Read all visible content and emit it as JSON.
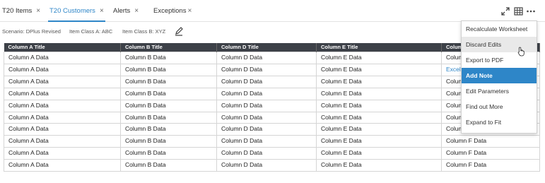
{
  "tabs": [
    {
      "label": "T20 Items",
      "active": false
    },
    {
      "label": "T20 Customers",
      "active": true
    },
    {
      "label": "Alerts",
      "active": false
    },
    {
      "label": "Exceptions",
      "active": false
    }
  ],
  "tab_close_glyph": "×",
  "toolbar": {
    "icons": [
      "expand-icon",
      "grid-icon",
      "more-icon"
    ]
  },
  "scenario_bar": {
    "scenario": "Scenario: DPlus Revised",
    "item_class_a": "Item Class A: ABC",
    "item_class_b": "Item Class B: XYZ"
  },
  "table": {
    "columns": [
      "Column A Title",
      "Column B Title",
      "Column D Title",
      "Column E Title",
      "Column F Title"
    ],
    "rows": [
      [
        "Column A Data",
        "Column B Data",
        "Column D Data",
        "Column E Data",
        "Column F Data"
      ],
      [
        "Column A Data",
        "Column B Data",
        "Column D Data",
        "Column E Data",
        "Excel"
      ],
      [
        "Column A Data",
        "Column B Data",
        "Column D Data",
        "Column E Data",
        "Column F Data"
      ],
      [
        "Column A Data",
        "Column B Data",
        "Column D Data",
        "Column E Data",
        "Column F Data"
      ],
      [
        "Column A Data",
        "Column B Data",
        "Column D Data",
        "Column E Data",
        "Column F Data"
      ],
      [
        "Column A Data",
        "Column B Data",
        "Column D Data",
        "Column E Data",
        "Column F Data"
      ],
      [
        "Column A Data",
        "Column B Data",
        "Column D Data",
        "Column E Data",
        "Column F Data"
      ],
      [
        "Column A Data",
        "Column B Data",
        "Column D Data",
        "Column E Data",
        "Column F Data"
      ],
      [
        "Column A Data",
        "Column B Data",
        "Column D Data",
        "Column E Data",
        "Column F Data"
      ],
      [
        "Column A Data",
        "Column B Data",
        "Column D Data",
        "Column E Data",
        "Column F Data"
      ]
    ],
    "link_cell": {
      "row": 1,
      "col": 4
    }
  },
  "menu": {
    "items": [
      {
        "label": "Recalculate Worksheet",
        "state": "normal"
      },
      {
        "label": "Discard Edits",
        "state": "hover"
      },
      {
        "label": "Export to PDF",
        "state": "normal"
      },
      {
        "label": "Add Note",
        "state": "selected"
      },
      {
        "label": "Edit Parameters",
        "state": "normal"
      },
      {
        "label": "Find out More",
        "state": "normal"
      },
      {
        "label": "Expand to Fit",
        "state": "normal"
      }
    ]
  },
  "colors": {
    "accent": "#2e86c8",
    "header_bg": "#3d4148",
    "hover_bg": "#e9e9e9"
  }
}
